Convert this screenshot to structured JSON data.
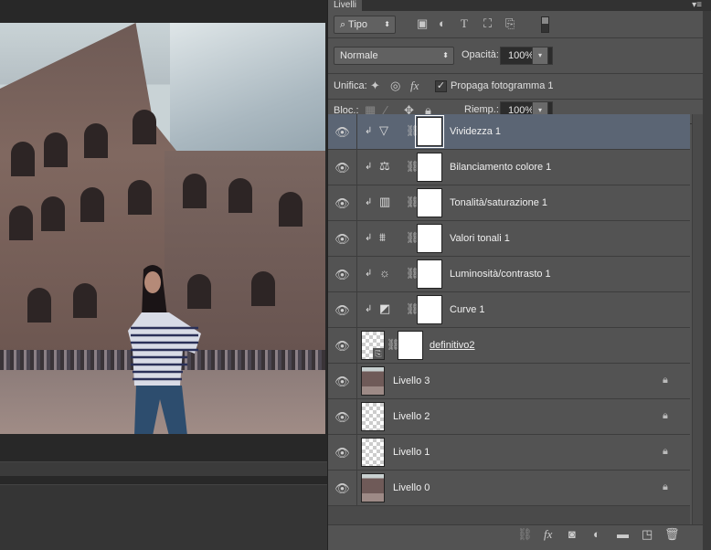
{
  "panel": {
    "title": "Livelli",
    "menu_icon": "panel-menu-icon"
  },
  "filter": {
    "kind": "Tipo",
    "icons": [
      "image-filter-icon",
      "adjustment-filter-icon",
      "type-filter-icon",
      "shape-filter-icon",
      "smart-object-filter-icon"
    ]
  },
  "blend": {
    "mode": "Normale",
    "opacity_label": "Opacità:",
    "opacity": "100%"
  },
  "unify": {
    "label": "Unifica:",
    "propagate_label": "Propaga fotogramma 1",
    "propagate_checked": true
  },
  "lock": {
    "label": "Bloc.:",
    "fill_label": "Riemp.:",
    "fill": "100%"
  },
  "layers": [
    {
      "name": "Vividezza 1",
      "type": "adjustment",
      "icon": "▽",
      "selected": true
    },
    {
      "name": "Bilanciamento colore 1",
      "type": "adjustment",
      "icon": "⚖"
    },
    {
      "name": "Tonalità/saturazione 1",
      "type": "adjustment",
      "icon": "▥"
    },
    {
      "name": "Valori tonali 1",
      "type": "adjustment",
      "icon": "⩩"
    },
    {
      "name": "Luminosità/contrasto 1",
      "type": "adjustment",
      "icon": "☼"
    },
    {
      "name": "Curve 1",
      "type": "adjustment",
      "icon": "◩"
    },
    {
      "name": "definitivo2",
      "type": "smart-object"
    },
    {
      "name": "Livello 3",
      "type": "pixel",
      "locked": true
    },
    {
      "name": "Livello 2",
      "type": "pixel",
      "locked": true
    },
    {
      "name": "Livello 1",
      "type": "pixel",
      "locked": true
    },
    {
      "name": "Livello 0",
      "type": "pixel",
      "locked": true
    }
  ],
  "footer": {
    "fx": "fx"
  }
}
